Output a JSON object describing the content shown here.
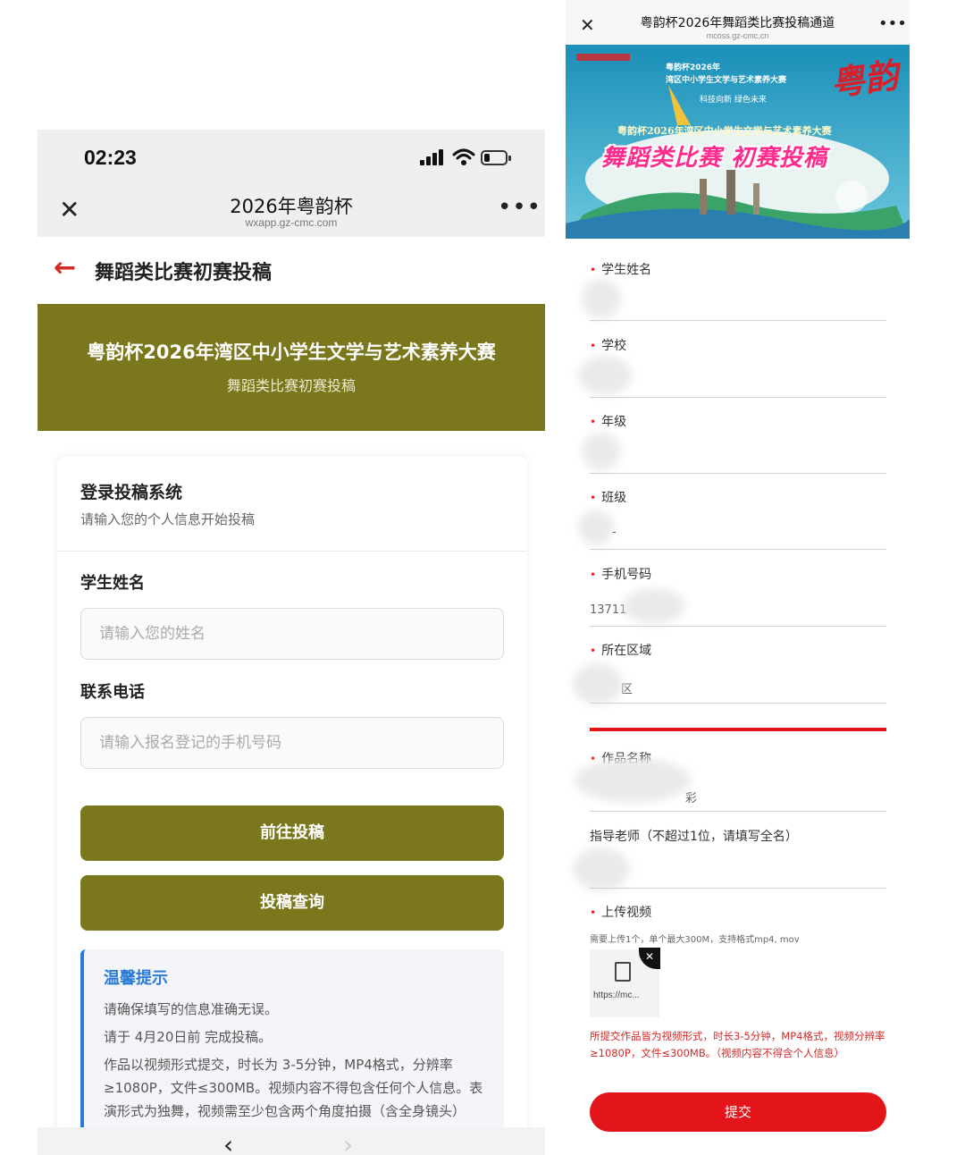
{
  "left": {
    "status": {
      "time": "02:23"
    },
    "nav": {
      "title": "2026年粤韵杯",
      "domain": "wxapp.gz-cmc.com",
      "more": "•••"
    },
    "page_title": "舞蹈类比赛初赛投稿",
    "banner": {
      "title": "粤韵杯2026年湾区中小学生文学与艺术素养大赛",
      "subtitle": "舞蹈类比赛初赛投稿"
    },
    "login": {
      "title": "登录投稿系统",
      "subtitle": "请输入您的个人信息开始投稿",
      "name_label": "学生姓名",
      "name_placeholder": "请输入您的姓名",
      "phone_label": "联系电话",
      "phone_placeholder": "请输入报名登记的手机号码",
      "submit_button": "前往投稿",
      "query_button": "投稿查询"
    },
    "tips": {
      "title": "温馨提示",
      "items": [
        "请确保填写的信息准确无误。",
        "请于 4月20日前 完成投稿。",
        "作品以视频形式提交，时长为 3-5分钟，MP4格式，分辨率≥1080P，文件≤300MB。视频内容不得包含任何个人信息。表演形式为独舞，视频需至少包含两个角度拍摄（含全身镜头）"
      ]
    },
    "accent_color": "#7a771c"
  },
  "right": {
    "nav": {
      "title": "粤韵杯2026年舞蹈类比赛投稿通道",
      "domain": "mcoss.gz-cmc.cn",
      "more": "•••"
    },
    "hero": {
      "line1": "粤韵杯2026年",
      "line2": "湾区中小学生文学与艺术素养大赛",
      "line3": "科技向新 绿色未来",
      "line4": "粤韵杯2026年湾区中小学生文学与艺术素养大赛",
      "headline": "舞蹈类比赛  初赛投稿",
      "logo": "粤韵"
    },
    "fields": {
      "name_label": "学生姓名",
      "school_label": "学校",
      "grade_label": "年级",
      "class_label": "班级",
      "class_value": "-",
      "phone_label": "手机号码",
      "phone_value": "13711",
      "region_label": "所在区域",
      "region_value": "区",
      "work_label": "作品名称",
      "work_value": "彩",
      "teacher_label": "指导老师（不超过1位，请填写全名）",
      "video_label": "上传视频",
      "video_hint": "需要上传1个，单个最大300M，支持格式mp4, mov",
      "upload_url": "https://mc...",
      "required_mark": "•"
    },
    "notice": "所提交作品皆为视频形式，时长3-5分钟，MP4格式，视频分辨率≥1080P，文件≤300MB。（视频内容不得含个人信息）",
    "submit_button": "提交",
    "accent_color": "#e4141b"
  }
}
